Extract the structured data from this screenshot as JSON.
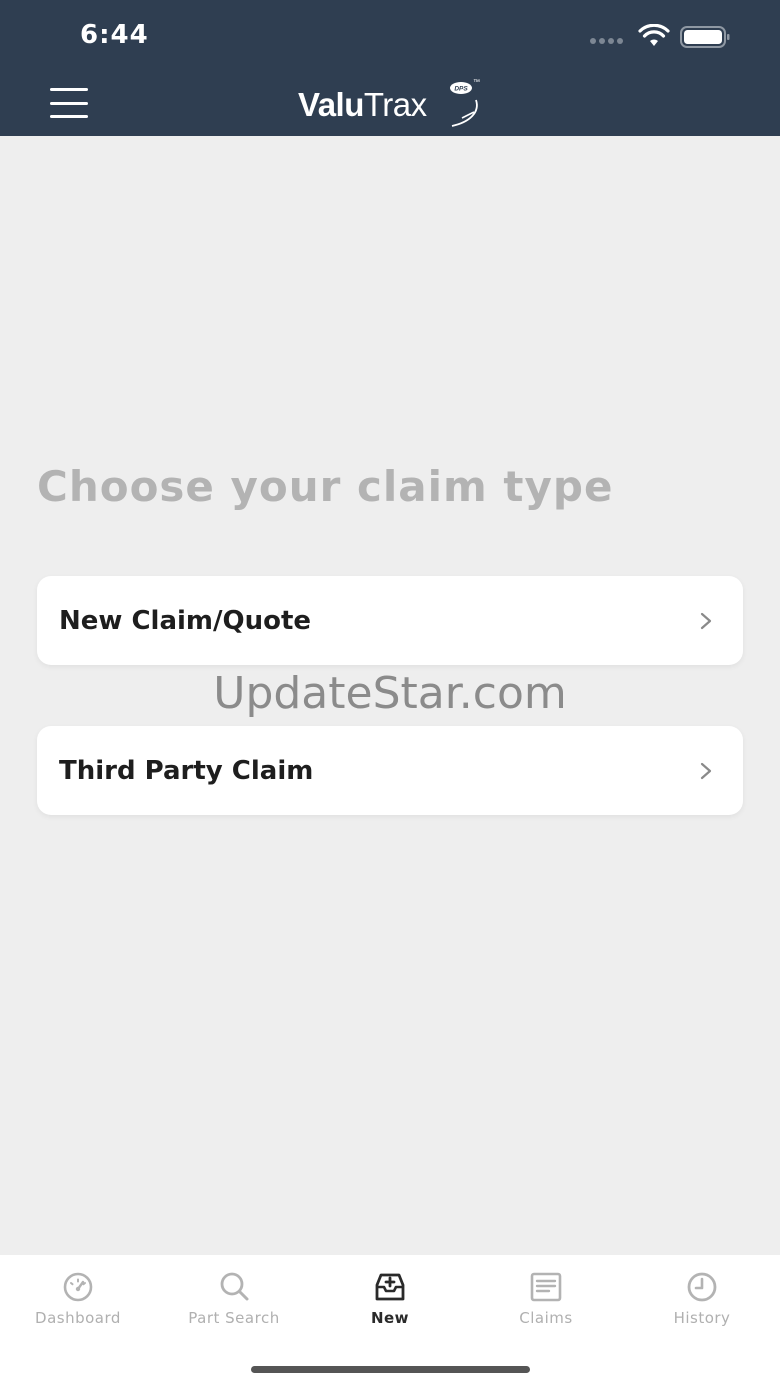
{
  "status_bar": {
    "time": "6:44"
  },
  "header": {
    "logo_bold": "Valu",
    "logo_light": "Trax",
    "logo_badge": "DPS",
    "logo_tm": "™",
    "background_color": "#2f3e51"
  },
  "main": {
    "title": "Choose your claim type",
    "options": [
      {
        "label": "New Claim/Quote",
        "icon": "chevron-right-icon"
      },
      {
        "label": "Third Party Claim",
        "icon": "chevron-right-icon"
      }
    ]
  },
  "watermark": "UpdateStar.com",
  "tabbar": {
    "tabs": [
      {
        "label": "Dashboard",
        "icon": "gauge-icon",
        "active": false
      },
      {
        "label": "Part Search",
        "icon": "search-icon",
        "active": false
      },
      {
        "label": "New",
        "icon": "inbox-plus-icon",
        "active": true
      },
      {
        "label": "Claims",
        "icon": "document-icon",
        "active": false
      },
      {
        "label": "History",
        "icon": "clock-icon",
        "active": false
      }
    ]
  }
}
